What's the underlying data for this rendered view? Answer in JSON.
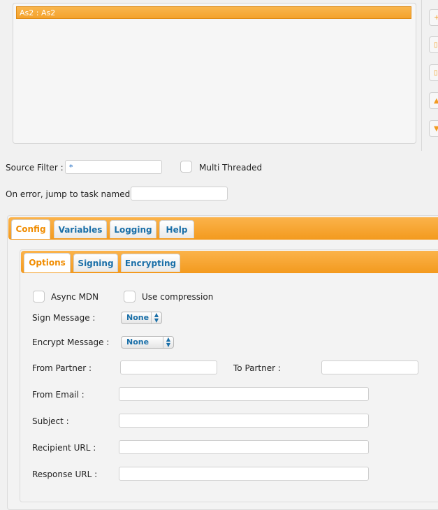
{
  "task_list": {
    "items": [
      {
        "label": "As2 : As2"
      }
    ]
  },
  "side_buttons": [
    {
      "icon": "plus-icon",
      "glyph": "+"
    },
    {
      "icon": "edit-icon",
      "glyph": "▯"
    },
    {
      "icon": "delete-icon",
      "glyph": "▯"
    },
    {
      "icon": "move-up-icon",
      "glyph": "▲"
    },
    {
      "icon": "move-down-icon",
      "glyph": "▼"
    }
  ],
  "source_filter": {
    "label": "Source Filter :",
    "value": "*"
  },
  "multi_threaded": {
    "label": "Multi Threaded",
    "checked": false
  },
  "on_error": {
    "label": "On error, jump to task named :",
    "value": ""
  },
  "outer_tabs": [
    {
      "label": "Config",
      "active": true
    },
    {
      "label": "Variables"
    },
    {
      "label": "Logging"
    },
    {
      "label": "Help"
    }
  ],
  "inner_tabs": [
    {
      "label": "Options",
      "active": true
    },
    {
      "label": "Signing"
    },
    {
      "label": "Encrypting"
    }
  ],
  "options": {
    "async_mdn": {
      "label": "Async MDN",
      "checked": false
    },
    "use_compression": {
      "label": "Use compression",
      "checked": false
    },
    "sign_message": {
      "label": "Sign Message :",
      "value": "None"
    },
    "encrypt_message": {
      "label": "Encrypt Message :",
      "value": "None"
    },
    "from_partner": {
      "label": "From Partner :",
      "value": ""
    },
    "to_partner": {
      "label": "To Partner :",
      "value": ""
    },
    "from_email": {
      "label": "From Email :",
      "value": ""
    },
    "subject": {
      "label": "Subject :",
      "value": ""
    },
    "recipient_url": {
      "label": "Recipient URL :",
      "value": ""
    },
    "response_url": {
      "label": "Response URL :",
      "value": ""
    }
  },
  "colors": {
    "accent": "#f4a22c",
    "tab_text": "#1a6fa8",
    "active_tab_text": "#f08c00"
  }
}
